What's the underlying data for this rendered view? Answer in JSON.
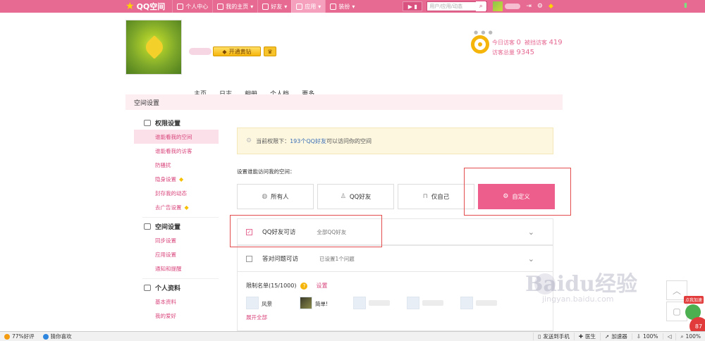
{
  "topbar": {
    "logo_text": "QQ空间",
    "nav": [
      {
        "label": "个人中心",
        "icon": "person-icon"
      },
      {
        "label": "我的主页",
        "icon": "home-icon"
      },
      {
        "label": "好友",
        "icon": "friends-icon"
      },
      {
        "label": "应用",
        "icon": "apps-icon"
      },
      {
        "label": "装扮",
        "icon": "shirt-icon"
      }
    ],
    "active_nav": "应用",
    "search_placeholder": "用户/应用/动态"
  },
  "header": {
    "vip_label": "开通黄钻",
    "visitors": {
      "today_label": "今日访客",
      "today_value": "0",
      "blocked_label": "被挡访客",
      "blocked_value": "419",
      "total_label": "访客总量",
      "total_value": "9345"
    }
  },
  "tabs": [
    "主页",
    "日志",
    "相册",
    "个人档",
    "更多"
  ],
  "settings_title": "空间设置",
  "sidebar": {
    "groups": [
      {
        "title": "权限设置",
        "icon": "lock-icon",
        "items": [
          {
            "label": "谁能看我的空间",
            "selected": true,
            "diamond": false
          },
          {
            "label": "谁能看我的访客",
            "selected": false,
            "diamond": false
          },
          {
            "label": "防骚扰",
            "selected": false,
            "diamond": false
          },
          {
            "label": "隐身设置",
            "selected": false,
            "diamond": true
          },
          {
            "label": "封存我的动态",
            "selected": false,
            "diamond": false
          },
          {
            "label": "去广告设置",
            "selected": false,
            "diamond": true
          }
        ]
      },
      {
        "title": "空间设置",
        "icon": "speaker-icon",
        "items": [
          {
            "label": "同步设置",
            "selected": false,
            "diamond": false
          },
          {
            "label": "应用设置",
            "selected": false,
            "diamond": false
          },
          {
            "label": "通知和提醒",
            "selected": false,
            "diamond": false
          }
        ]
      },
      {
        "title": "个人资料",
        "icon": "profile-card-icon",
        "items": [
          {
            "label": "基本资料",
            "selected": false,
            "diamond": false
          },
          {
            "label": "我的爱好",
            "selected": false,
            "diamond": false
          }
        ]
      }
    ]
  },
  "main": {
    "notice_prefix": "当前权限下：",
    "notice_highlight": "193个QQ好友",
    "notice_suffix": "可以访问你的空间",
    "choose_label": "设置谁能访问我的空间：",
    "options": [
      {
        "label": "所有人",
        "icon": "globe-icon",
        "selected": false
      },
      {
        "label": "QQ好友",
        "icon": "qq-penguin-icon",
        "selected": false
      },
      {
        "label": "仅自己",
        "icon": "lock-icon",
        "selected": false
      },
      {
        "label": "自定义",
        "icon": "gear-icon",
        "selected": true
      }
    ],
    "rules": [
      {
        "label": "QQ好友可访",
        "sub": "全部QQ好友",
        "checked": true
      },
      {
        "label": "答对问题可访",
        "sub": "已设置1个问题",
        "checked": false
      }
    ],
    "limit": {
      "title": "限制名单(15/1000)",
      "setting_link": "设置",
      "friends": [
        {
          "name": "风景",
          "has_photo": false
        },
        {
          "name": "简单!",
          "has_photo": true
        },
        {
          "name": "",
          "has_photo": false
        },
        {
          "name": "",
          "has_photo": false
        },
        {
          "name": "",
          "has_photo": false
        }
      ],
      "expand_label": "展开全部"
    }
  },
  "watermark": {
    "text": "Baidu经验",
    "sub": "jingyan.baidu.com"
  },
  "speed_widget": {
    "label": "点我加速",
    "value": "87"
  },
  "statusbar": {
    "left": [
      {
        "label": "77%好评",
        "color": "#f39c12"
      },
      {
        "label": "猜你喜欢",
        "color": "#2e86de"
      }
    ],
    "right": [
      "发送到手机",
      "医生",
      "加速器",
      "100%",
      "100%"
    ]
  }
}
